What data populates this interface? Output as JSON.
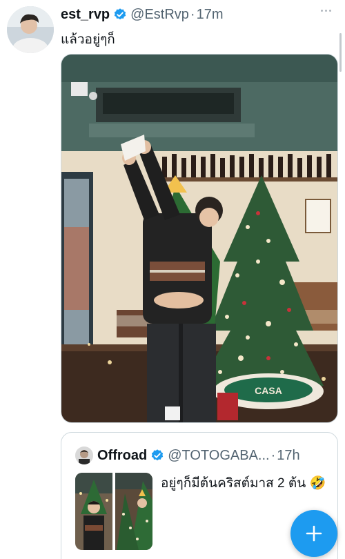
{
  "tweet": {
    "display_name": "est_rvp",
    "handle": "@EstRvp",
    "separator": "·",
    "time": "17m",
    "text": "แล้วอยู่ๆก็"
  },
  "quoted_tweet": {
    "display_name": "Offroad",
    "handle": "@TOTOGABA...",
    "separator": "·",
    "time": "17h",
    "text": "อยู่ๆก็มีต้นคริสต์มาส 2 ต้น 🤣"
  },
  "media_sign": "CASA",
  "colors": {
    "accent": "#1d9bf0",
    "secondary_text": "#536471",
    "border": "#cfd9de"
  },
  "icons": [
    "verified-badge-icon",
    "more-icon",
    "plus-icon"
  ]
}
